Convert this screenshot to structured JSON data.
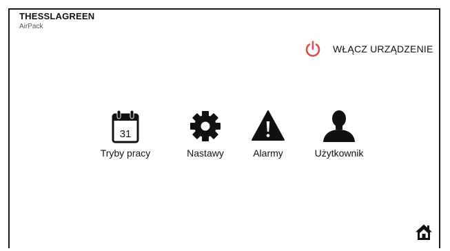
{
  "brand": {
    "title": "THESSLAGREEN",
    "subtitle": "AirPack"
  },
  "power": {
    "label": "WŁĄCZ URZĄDZENIE",
    "icon": "power-icon",
    "color": "#e04b4b"
  },
  "menu": [
    {
      "label": "Tryby pracy",
      "icon": "calendar-icon",
      "calendar_day": "31"
    },
    {
      "label": "Nastawy",
      "icon": "gear-icon"
    },
    {
      "label": "Alarmy",
      "icon": "warning-icon"
    },
    {
      "label": "Użytkownik",
      "icon": "user-icon"
    }
  ],
  "footer": {
    "icon": "home-icon"
  }
}
